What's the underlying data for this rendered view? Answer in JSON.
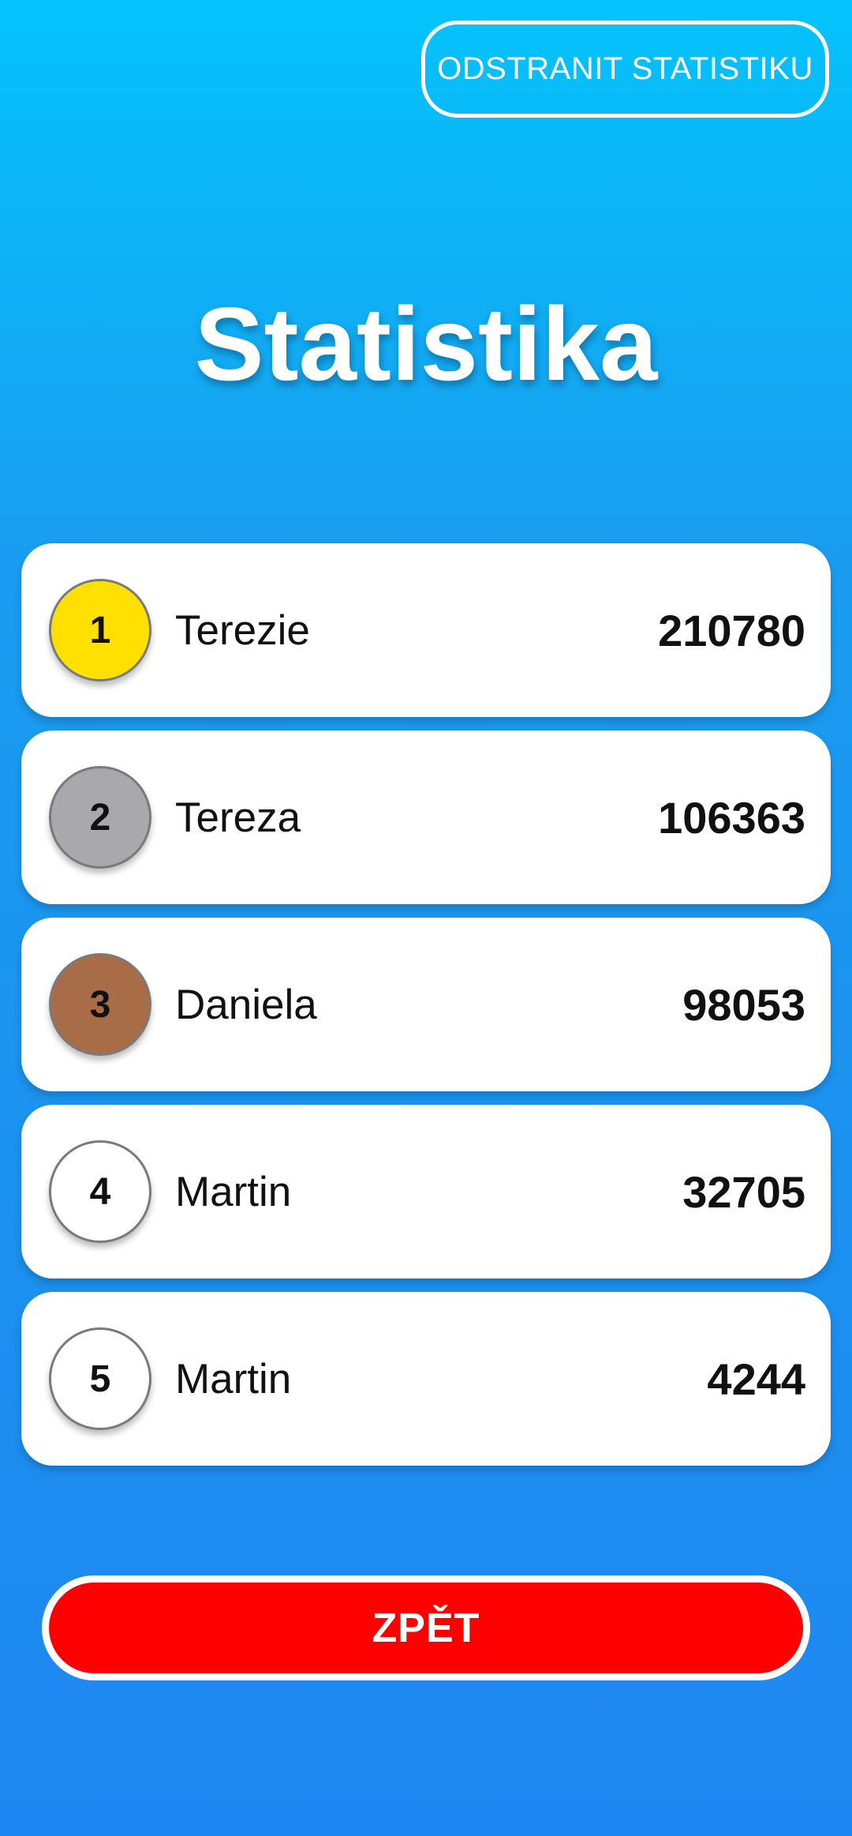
{
  "header": {
    "clear_stats_label": "ODSTRANIT STATISTIKU"
  },
  "page": {
    "title": "Statistika"
  },
  "leaderboard": [
    {
      "rank": "1",
      "name": "Terezie",
      "score": "210780",
      "medal_color": "#ffe000"
    },
    {
      "rank": "2",
      "name": "Tereza",
      "score": "106363",
      "medal_color": "#a8a8ad"
    },
    {
      "rank": "3",
      "name": "Daniela",
      "score": "98053",
      "medal_color": "#a86d47"
    },
    {
      "rank": "4",
      "name": "Martin",
      "score": "32705",
      "medal_color": "#ffffff"
    },
    {
      "rank": "5",
      "name": "Martin",
      "score": "4244",
      "medal_color": "#ffffff"
    }
  ],
  "footer": {
    "back_label": "ZPĚT"
  },
  "colors": {
    "background_top": "#04c3fc",
    "background_bottom": "#1e86f0",
    "back_button": "#ff0000"
  }
}
